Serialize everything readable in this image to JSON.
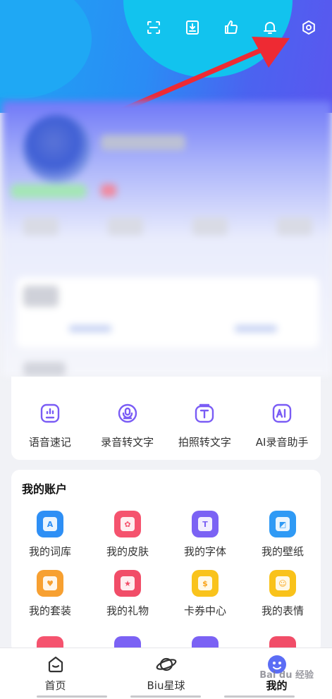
{
  "toolbar": {
    "icons": [
      "scan-icon",
      "download-icon",
      "thumbs-up-icon",
      "bell-icon",
      "settings-icon"
    ]
  },
  "tools": [
    {
      "label": "语音速记",
      "icon": "voice-note-icon",
      "color": "#7a5cf5"
    },
    {
      "label": "录音转文字",
      "icon": "recording-to-text-icon",
      "color": "#7a5cf5"
    },
    {
      "label": "拍照转文字",
      "icon": "photo-to-text-icon",
      "color": "#7a5cf5"
    },
    {
      "label": "AI录音助手",
      "icon": "ai-recording-icon",
      "color": "#7a5cf5"
    }
  ],
  "account": {
    "title": "我的账户",
    "items": [
      {
        "label": "我的词库",
        "icon": "dictionary-icon",
        "color": "#2e8ff5",
        "glyph": "A"
      },
      {
        "label": "我的皮肤",
        "icon": "skin-icon",
        "color": "#f5536e",
        "glyph": "✿"
      },
      {
        "label": "我的字体",
        "icon": "font-icon",
        "color": "#7b62f4",
        "glyph": "T"
      },
      {
        "label": "我的壁纸",
        "icon": "wallpaper-icon",
        "color": "#2f9af5",
        "glyph": "◩"
      },
      {
        "label": "我的套装",
        "icon": "suit-icon",
        "color": "#f7a031",
        "glyph": "♥"
      },
      {
        "label": "我的礼物",
        "icon": "gift-icon",
        "color": "#f14d68",
        "glyph": "★"
      },
      {
        "label": "卡券中心",
        "icon": "coupon-icon",
        "color": "#f9c31c",
        "glyph": "$"
      },
      {
        "label": "我的表情",
        "icon": "emoji-icon",
        "color": "#f9c21a",
        "glyph": "☺"
      }
    ],
    "partial_colors": [
      "#f5536e",
      "#7b62f4",
      "#7b62f4",
      "#f14d68"
    ]
  },
  "nav": [
    {
      "label": "首页",
      "icon": "home-icon"
    },
    {
      "label": "Biu星球",
      "icon": "planet-icon"
    },
    {
      "label": "我的",
      "icon": "profile-icon"
    }
  ],
  "watermark": "Bai du 经验"
}
